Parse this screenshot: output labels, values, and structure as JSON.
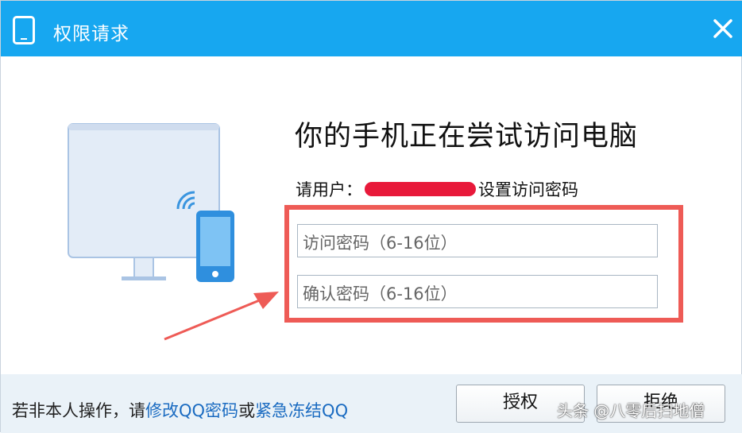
{
  "window": {
    "title": "权限请求",
    "close_icon": "close-icon"
  },
  "main": {
    "headline": "你的手机正在尝试访问电脑",
    "instruction_prefix": "请用户：",
    "instruction_suffix": "设置访问密码",
    "fields": {
      "access_password_placeholder": "访问密码（6-16位）",
      "confirm_password_placeholder": "确认密码（6-16位）"
    }
  },
  "footer": {
    "prefix": "若非本人操作，请",
    "link_change": "修改QQ密码",
    "connector": "或",
    "link_freeze": "紧急冻结QQ"
  },
  "buttons": {
    "authorize": "授权",
    "reject": "拒绝"
  },
  "watermark": "头条 @八零后扫地僧",
  "colors": {
    "titlebar": "#17a7f0",
    "highlight": "#ee5b56",
    "link": "#1a6bc1"
  }
}
